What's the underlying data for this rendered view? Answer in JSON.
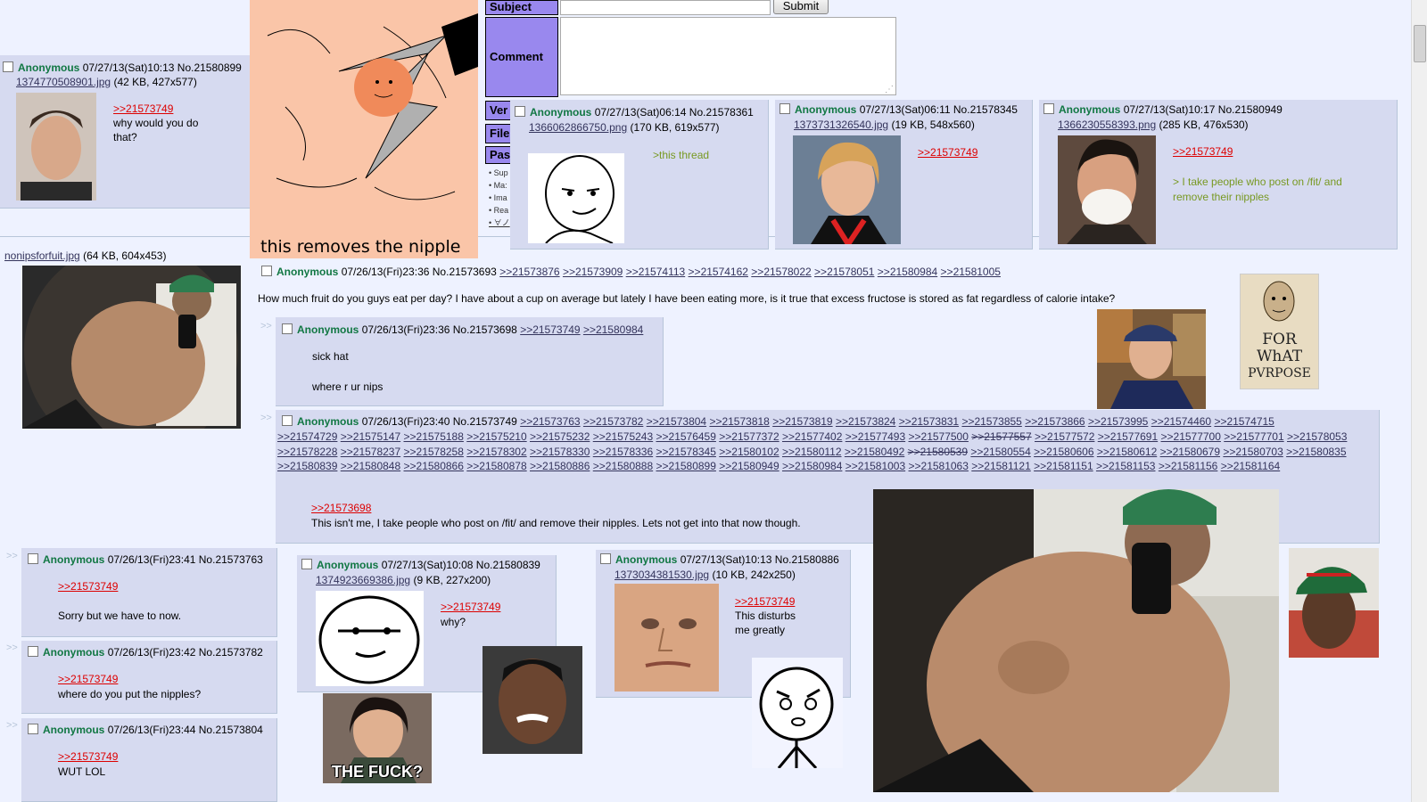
{
  "form": {
    "subject_label": "Subject",
    "submit_label": "Submit",
    "comment_label": "Comment",
    "ver_label": "Ver",
    "file_label": "File",
    "pass_label": "Pas",
    "rules": [
      "• Sup",
      "• Ma:",
      "• Ima",
      "• Rea",
      "• ∀ノ"
    ]
  },
  "op": {
    "file": "nonipsforfuit.jpg",
    "file_meta": "(64 KB, 604x453)",
    "name": "Anonymous",
    "datetime": "07/26/13(Fri)23:36",
    "no": "No.21573693",
    "backlinks": [
      ">>21573876",
      ">>21573909",
      ">>21574113",
      ">>21574162",
      ">>21578022",
      ">>21578051",
      ">>21580984",
      ">>21581005"
    ],
    "body": "How much fruit do you guys eat per day? I have about a cup on average but lately I have been eating more, is it true that excess fructose is stored as fat regardless of calorie intake?"
  },
  "image_captions": {
    "nipple_meme": "this removes the nipple",
    "for_what": [
      "FOR",
      "WhAT",
      "PVRPOSE"
    ],
    "the_fuck": "THE FUCK?"
  },
  "reply_arrow": ">>",
  "posts": {
    "p21580899": {
      "name": "Anonymous",
      "datetime": "07/27/13(Sat)10:13",
      "no": "No.21580899",
      "file": "1374770508901.jpg",
      "file_meta": "(42 KB, 427x577)",
      "quote": ">>21573749",
      "text": [
        "why would you do",
        "that?"
      ]
    },
    "p21578361": {
      "name": "Anonymous",
      "datetime": "07/27/13(Sat)06:14",
      "no": "No.21578361",
      "file": "1366062866750.png",
      "file_meta": "(170 KB, 619x577)",
      "greentext": ">this thread"
    },
    "p21578345": {
      "name": "Anonymous",
      "datetime": "07/27/13(Sat)06:11",
      "no": "No.21578345",
      "file": "1373731326540.jpg",
      "file_meta": "(19 KB, 548x560)",
      "quote": ">>21573749"
    },
    "p21580949": {
      "name": "Anonymous",
      "datetime": "07/27/13(Sat)10:17",
      "no": "No.21580949",
      "file": "1366230558393.png",
      "file_meta": "(285 KB, 476x530)",
      "quote": ">>21573749",
      "greentext": [
        "> I take people who post on /fit/ and",
        "remove their nipples"
      ]
    },
    "p21573698": {
      "name": "Anonymous",
      "datetime": "07/26/13(Fri)23:36",
      "no": "No.21573698",
      "backlinks": [
        ">>21573749",
        ">>21580984"
      ],
      "text": [
        "sick hat",
        "where r ur nips"
      ]
    },
    "p21573749": {
      "name": "Anonymous",
      "datetime": "07/26/13(Fri)23:40",
      "no": "No.21573749",
      "backlinks_line1": [
        ">>21573763",
        ">>21573782",
        ">>21573804",
        ">>21573818",
        ">>21573819",
        ">>21573824",
        ">>21573831",
        ">>21573855",
        ">>21573866",
        ">>21573995",
        ">>21574460",
        ">>21574715"
      ],
      "backlinks_rest": [
        ">>21574729",
        ">>21575147",
        ">>21575188",
        ">>21575210",
        ">>21575232",
        ">>21575243",
        ">>21576459",
        ">>21577372",
        ">>21577402",
        ">>21577493",
        ">>21577500",
        ">>21577557",
        ">>21577572",
        ">>21577691",
        ">>21577700",
        ">>21577701",
        ">>21578053",
        ">>21578228",
        ">>21578237",
        ">>21578258",
        ">>21578302",
        ">>21578330",
        ">>21578336",
        ">>21578345",
        ">>21580102",
        ">>21580112",
        ">>21580492",
        ">>21580539",
        ">>21580554",
        ">>21580606",
        ">>21580612",
        ">>21580679",
        ">>21580703",
        ">>21580835",
        ">>21580839",
        ">>21580848",
        ">>21580866",
        ">>21580878",
        ">>21580886",
        ">>21580888",
        ">>21580899",
        ">>21580949",
        ">>21580984",
        ">>21581003",
        ">>21581063",
        ">>21581121",
        ">>21581151",
        ">>21581153",
        ">>21581156",
        ">>21581164"
      ],
      "quote": ">>21573698",
      "text": "This isn't me, I take people who post on /fit/ and remove their nipples. Lets not get into that now though."
    },
    "p21573763": {
      "name": "Anonymous",
      "datetime": "07/26/13(Fri)23:41",
      "no": "No.21573763",
      "quote": ">>21573749",
      "text": "Sorry but we have to now."
    },
    "p21573782": {
      "name": "Anonymous",
      "datetime": "07/26/13(Fri)23:42",
      "no": "No.21573782",
      "quote": ">>21573749",
      "text": "where do you put the nipples?"
    },
    "p21573804": {
      "name": "Anonymous",
      "datetime": "07/26/13(Fri)23:44",
      "no": "No.21573804",
      "quote": ">>21573749",
      "text": "WUT LOL"
    },
    "p21580839": {
      "name": "Anonymous",
      "datetime": "07/27/13(Sat)10:08",
      "no": "No.21580839",
      "file": "1374923669386.jpg",
      "file_meta": "(9 KB, 227x200)",
      "quote": ">>21573749",
      "text": "why?"
    },
    "p21580886": {
      "name": "Anonymous",
      "datetime": "07/27/13(Sat)10:13",
      "no": "No.21580886",
      "file": "1373034381530.jpg",
      "file_meta": "(10 KB, 242x250)",
      "quote": ">>21573749",
      "text": [
        "This disturbs",
        "me greatly"
      ]
    }
  },
  "colors": {
    "background": "#eef2ff",
    "reply_bg": "#d6daf0",
    "name_green": "#117743",
    "quote_red": "#dd0000",
    "greentext": "#789922",
    "form_label": "#9988ee"
  }
}
